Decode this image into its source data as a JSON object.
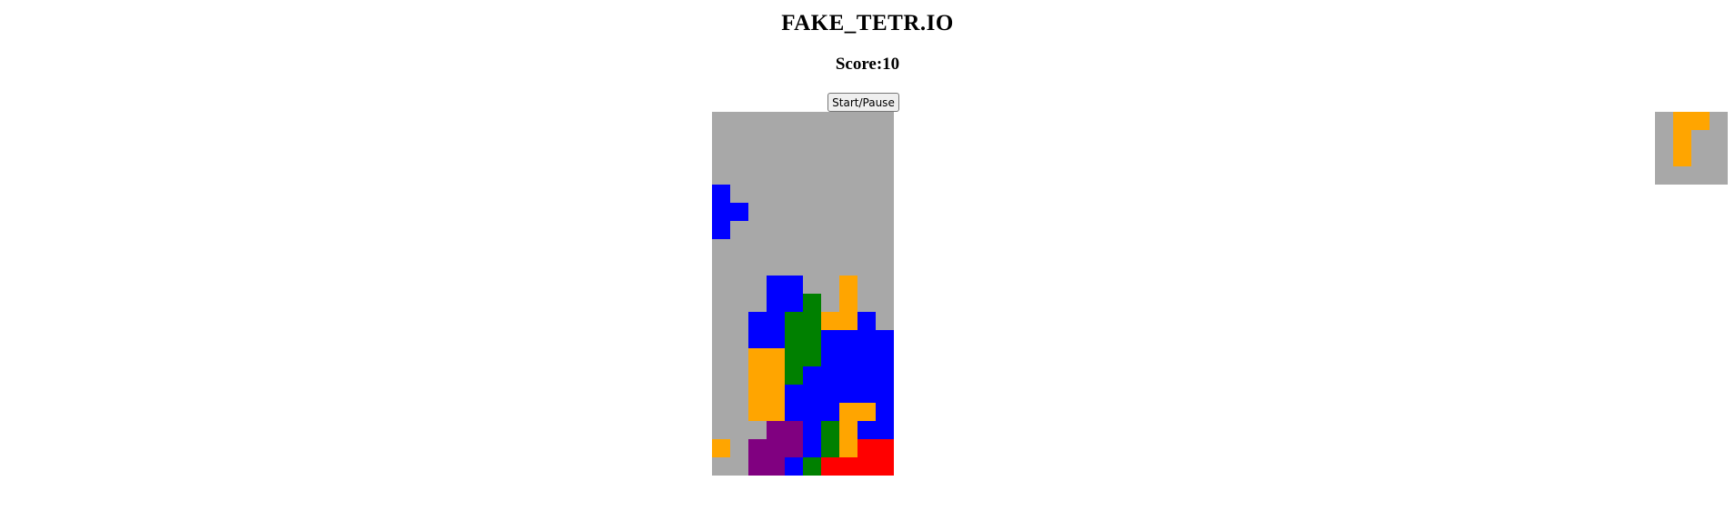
{
  "game": {
    "title": "FAKE_TETR.IO",
    "score_text": "Score:10",
    "start_pause_label": "Start/Pause"
  },
  "colors": {
    "background": "#a8a8a8",
    "O": "#ffa500",
    "B": "#0000ff",
    "G": "#008000",
    "P": "#800080",
    "R": "#ff0000"
  },
  "board": {
    "cols": 10,
    "rows": 20,
    "grid": [
      "..........",
      "..........",
      "..........",
      "..........",
      "..........",
      "B.........",
      "BB........",
      "B.........",
      "..........",
      "..........",
      "...BB..O..",
      "...BBG.O..",
      "..BBGGOOB.",
      "..BBGGBBBB",
      "..OOGGBBBB",
      "..OOGBBBBB",
      "..OOBBBBBB",
      "..OOBBBOOB",
      "...PPBGOBB",
      "O.PPPBGORR",
      "..PPBGRRRR"
    ]
  },
  "next_piece": {
    "cols": 4,
    "rows": 4,
    "grid": [
      ".OO.",
      ".O..",
      ".O..",
      "...."
    ]
  }
}
